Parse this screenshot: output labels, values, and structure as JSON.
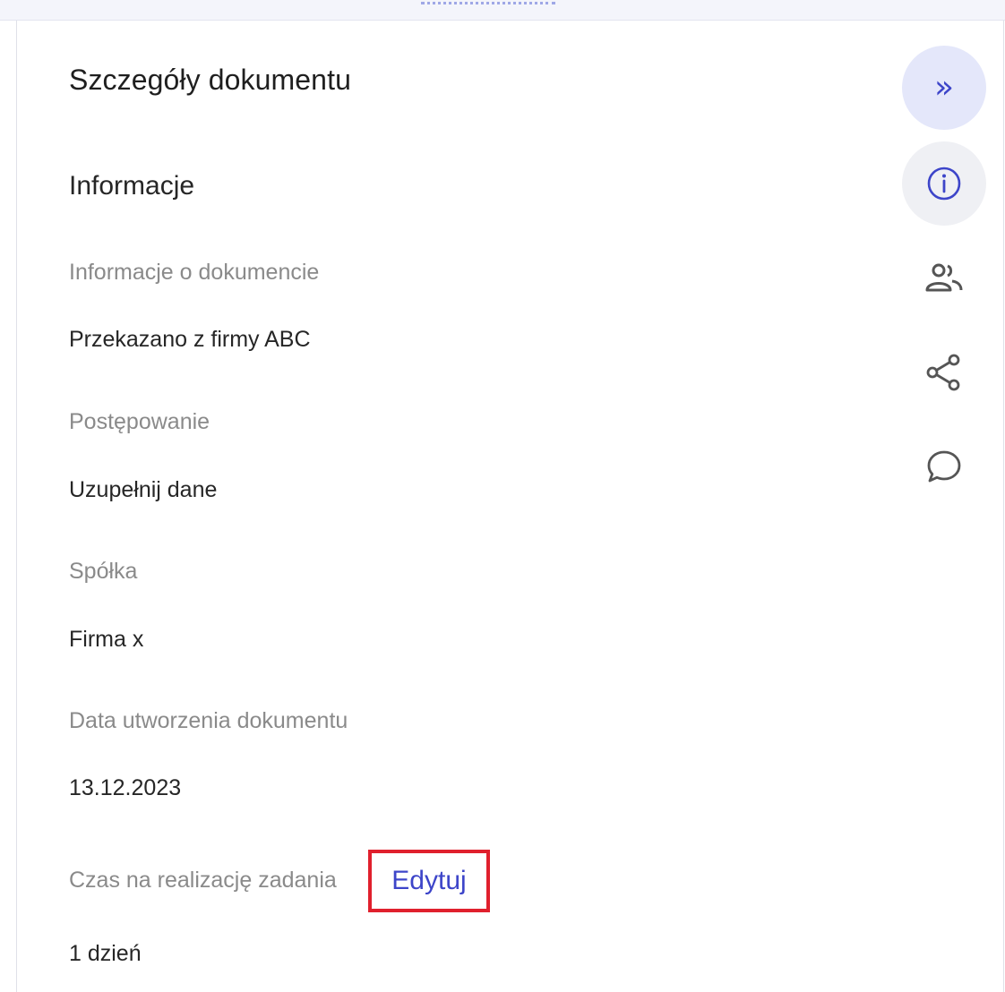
{
  "panel": {
    "title": "Szczegóły dokumentu",
    "section_title": "Informacje"
  },
  "fields": [
    {
      "label": "Informacje o dokumencie",
      "value": "Przekazano z firmy ABC"
    },
    {
      "label": "Postępowanie",
      "value": "Uzupełnij dane"
    },
    {
      "label": "Spółka",
      "value": "Firma x"
    },
    {
      "label": "Data utworzenia dokumentu",
      "value": "13.12.2023"
    },
    {
      "label": "Czas na realizację zadania",
      "value": "1 dzień"
    }
  ],
  "edit_link": {
    "label": "Edytuj",
    "highlight_color": "#e0202d"
  },
  "rail": {
    "collapse_glyph": "»",
    "icons": [
      "chevrons-right-icon",
      "info-icon",
      "people-icon",
      "share-icon",
      "comment-icon"
    ]
  },
  "colors": {
    "accent": "#3d45c9",
    "accent_bg": "#e4e7fa",
    "label_gray": "#8a8a8a",
    "text": "#262626"
  }
}
